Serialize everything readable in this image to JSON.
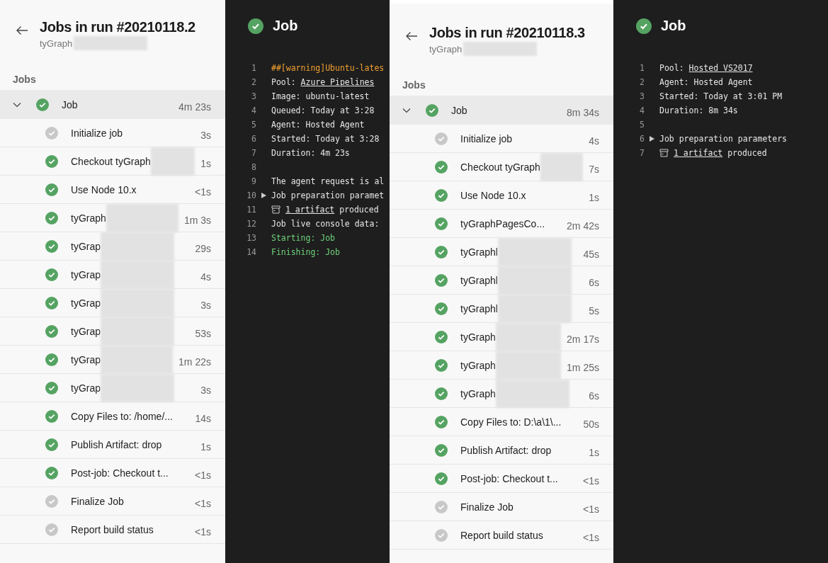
{
  "runs": [
    {
      "title": "Jobs in run #20210118.2",
      "subtitle": "tyGraph",
      "section": "Jobs",
      "job": {
        "name": "Job",
        "duration": "4m 23s",
        "skipped": false,
        "expanded": true
      },
      "steps": [
        {
          "name": "Initialize job",
          "duration": "3s",
          "skipped": true,
          "redacted": false
        },
        {
          "name": "Checkout tyGraph",
          "duration": "1s",
          "skipped": false,
          "redacted": true
        },
        {
          "name": "Use Node 10.x",
          "duration": "<1s",
          "skipped": false,
          "redacted": false
        },
        {
          "name": "tyGraph",
          "duration": "1m 3s",
          "skipped": false,
          "redacted": true
        },
        {
          "name": "tyGrap",
          "duration": "29s",
          "skipped": false,
          "redacted": true
        },
        {
          "name": "tyGrap",
          "duration": "4s",
          "skipped": false,
          "redacted": true
        },
        {
          "name": "tyGrap",
          "duration": "3s",
          "skipped": false,
          "redacted": true
        },
        {
          "name": "tyGrap",
          "duration": "53s",
          "skipped": false,
          "redacted": true
        },
        {
          "name": "tyGrap",
          "duration": "1m 22s",
          "skipped": false,
          "redacted": true
        },
        {
          "name": "tyGrap",
          "duration": "3s",
          "skipped": false,
          "redacted": true
        },
        {
          "name": "Copy Files to: /home/...",
          "duration": "14s",
          "skipped": false,
          "redacted": false
        },
        {
          "name": "Publish Artifact: drop",
          "duration": "1s",
          "skipped": false,
          "redacted": false
        },
        {
          "name": "Post-job: Checkout t...",
          "duration": "<1s",
          "skipped": false,
          "redacted": false
        },
        {
          "name": "Finalize Job",
          "duration": "<1s",
          "skipped": true,
          "redacted": false
        },
        {
          "name": "Report build status",
          "duration": "<1s",
          "skipped": true,
          "redacted": false
        }
      ],
      "console": {
        "title": "Job",
        "skipped": false,
        "lines": [
          {
            "num": "1",
            "kind": "warning",
            "text": "##[warning]Ubuntu-lates"
          },
          {
            "num": "2",
            "kind": "plain",
            "text": "Pool: ",
            "link": "Azure Pipelines"
          },
          {
            "num": "3",
            "kind": "plain",
            "text": "Image: ubuntu-latest"
          },
          {
            "num": "4",
            "kind": "plain",
            "text": "Queued: Today at 3:28"
          },
          {
            "num": "5",
            "kind": "plain",
            "text": "Agent: Hosted Agent"
          },
          {
            "num": "6",
            "kind": "plain",
            "text": "Started: Today at 3:28"
          },
          {
            "num": "7",
            "kind": "plain",
            "text": "Duration: 4m 23s"
          },
          {
            "num": "8",
            "kind": "plain"
          },
          {
            "num": "9",
            "kind": "plain",
            "text": "The agent request is al"
          },
          {
            "num": "10",
            "kind": "expander",
            "text": "Job preparation paramet"
          },
          {
            "num": "11",
            "kind": "artifact",
            "link": "1 artifact",
            "after": " produced"
          },
          {
            "num": "12",
            "kind": "plain",
            "text": "Job live console data:"
          },
          {
            "num": "13",
            "kind": "success",
            "text": "Starting: Job"
          },
          {
            "num": "14",
            "kind": "success",
            "text": "Finishing: Job"
          }
        ]
      }
    },
    {
      "title": "Jobs in run #20210118.3",
      "subtitle": "tyGraph",
      "section": "Jobs",
      "job": {
        "name": "Job",
        "duration": "8m 34s",
        "skipped": false,
        "expanded": true
      },
      "steps": [
        {
          "name": "Initialize job",
          "duration": "4s",
          "skipped": true,
          "redacted": false
        },
        {
          "name": "Checkout tyGraph",
          "duration": "7s",
          "skipped": false,
          "redacted": true
        },
        {
          "name": "Use Node 10.x",
          "duration": "1s",
          "skipped": false,
          "redacted": false
        },
        {
          "name": "tyGraphPagesCo...",
          "duration": "2m 42s",
          "skipped": false,
          "redacted": false
        },
        {
          "name": "tyGraphl",
          "duration": "45s",
          "skipped": false,
          "redacted": true
        },
        {
          "name": "tyGraphl",
          "duration": "6s",
          "skipped": false,
          "redacted": true
        },
        {
          "name": "tyGraphl",
          "duration": "5s",
          "skipped": false,
          "redacted": true
        },
        {
          "name": "tyGraph",
          "duration": "2m 17s",
          "skipped": false,
          "redacted": true
        },
        {
          "name": "tyGraph",
          "duration": "1m 25s",
          "skipped": false,
          "redacted": true
        },
        {
          "name": "tyGraph",
          "duration": "6s",
          "skipped": false,
          "redacted": true
        },
        {
          "name": "Copy Files to: D:\\a\\1\\...",
          "duration": "50s",
          "skipped": false,
          "redacted": false
        },
        {
          "name": "Publish Artifact: drop",
          "duration": "1s",
          "skipped": false,
          "redacted": false
        },
        {
          "name": "Post-job: Checkout t...",
          "duration": "<1s",
          "skipped": false,
          "redacted": false
        },
        {
          "name": "Finalize Job",
          "duration": "<1s",
          "skipped": true,
          "redacted": false
        },
        {
          "name": "Report build status",
          "duration": "<1s",
          "skipped": true,
          "redacted": false
        }
      ],
      "console": {
        "title": "Job",
        "skipped": false,
        "lines": [
          {
            "num": "1",
            "kind": "plain",
            "text": "Pool: ",
            "link": "Hosted VS2017"
          },
          {
            "num": "2",
            "kind": "plain",
            "text": "Agent: Hosted Agent"
          },
          {
            "num": "3",
            "kind": "plain",
            "text": "Started: Today at 3:01 PM"
          },
          {
            "num": "4",
            "kind": "plain",
            "text": "Duration: 8m 34s"
          },
          {
            "num": "5",
            "kind": "plain"
          },
          {
            "num": "6",
            "kind": "expander",
            "text": "Job preparation parameters"
          },
          {
            "num": "7",
            "kind": "artifact",
            "link": "1 artifact",
            "after": " produced"
          }
        ]
      }
    }
  ]
}
